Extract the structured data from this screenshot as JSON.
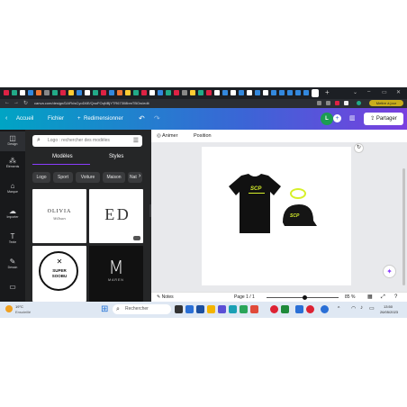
{
  "browser": {
    "url": "canva.com/design/DAFkIsCyoD6E/QnoFOqNBjYTR67308bmTBOw/edit",
    "update_button": "Mettre à jour"
  },
  "topbar": {
    "home": "Accueil",
    "file": "Fichier",
    "resize": "Redimensionner",
    "avatar_initial": "L",
    "share": "Partager"
  },
  "rail": [
    {
      "label": "Design",
      "icon": "design-icon"
    },
    {
      "label": "Éléments",
      "icon": "elements-icon"
    },
    {
      "label": "Marque",
      "icon": "brand-icon"
    },
    {
      "label": "Importer",
      "icon": "upload-icon"
    },
    {
      "label": "Texte",
      "icon": "text-icon"
    },
    {
      "label": "Dessin",
      "icon": "draw-icon"
    },
    {
      "label": "",
      "icon": "folder-icon"
    }
  ],
  "panel": {
    "search_placeholder": "Logo : rechercher des modèles",
    "tabs": [
      "Modèles",
      "Styles"
    ],
    "chips": [
      "Logo",
      "Sport",
      "Voiture",
      "Maison",
      "Nat"
    ],
    "templates": [
      {
        "line1": "OLIVIA",
        "line2": "Wilson"
      },
      {
        "line1": "E D",
        "line2": ""
      },
      {
        "line1": "SUPER",
        "line2": "SOOBU"
      },
      {
        "line1": "M",
        "line2": "MAREN"
      }
    ]
  },
  "editor": {
    "animate": "Animer",
    "position": "Position",
    "notes": "Notes",
    "page": "Page 1 / 1",
    "zoom": "85 %",
    "zoom_level": 0.85,
    "design": {
      "shirt_text": "SCP",
      "cap_text": "SCP"
    }
  },
  "taskbar": {
    "weather_temp": "19°C",
    "weather_desc": "Ensoleillé",
    "search": "Rechercher",
    "time": "13:50",
    "date": "26/05/2023"
  },
  "colors": {
    "brand_gradient_start": "#00a4c4",
    "brand_gradient_end": "#7a3fe0",
    "accent_yellow": "#d7f02a",
    "panel_bg": "#252627"
  }
}
